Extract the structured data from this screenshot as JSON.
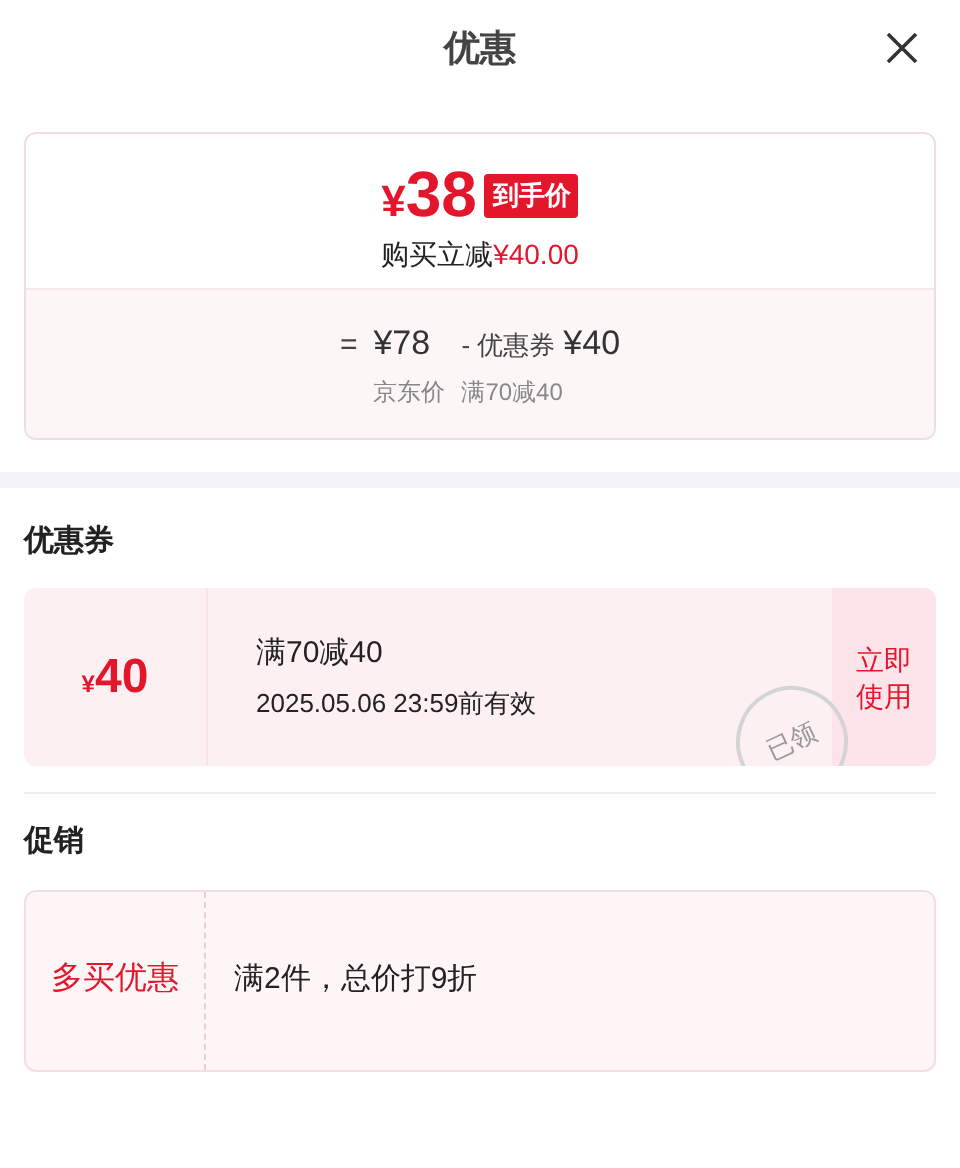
{
  "title": "优惠",
  "summary": {
    "currency": "¥",
    "price": "38",
    "badge": "到手价",
    "saving_label": "购买立减",
    "saving_amount": "¥40.00",
    "equals": "=",
    "base_price": "¥78",
    "minus": "-",
    "coupon_label": "优惠券",
    "coupon_amount": "¥40",
    "base_caption": "京东价",
    "coupon_caption": "满70减40"
  },
  "coupons": {
    "heading": "优惠券",
    "items": [
      {
        "currency": "¥",
        "amount": "40",
        "condition": "满70减40",
        "validity": "2025.05.06 23:59前有效",
        "stamp": "已领",
        "action": "立即使用"
      }
    ]
  },
  "promotions": {
    "heading": "促销",
    "items": [
      {
        "tag": "多买优惠",
        "description": "满2件，总价打9折"
      }
    ]
  }
}
